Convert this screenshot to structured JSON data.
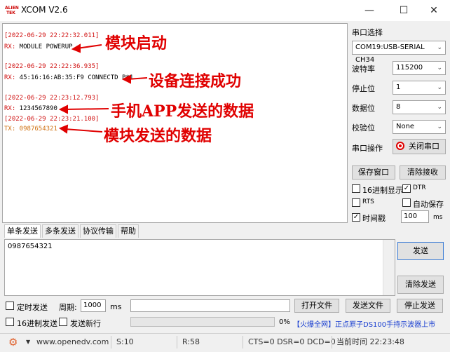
{
  "window": {
    "logo_text": "ALIEN TEK",
    "title": "XCOM V2.6"
  },
  "receive": {
    "lines": [
      {
        "ts": "[2022-06-29 22:22:32.011]",
        "dir": "RX:",
        "text": " MODULE POWERUP"
      },
      {
        "ts": "[2022-06-29 22:22:36.935]",
        "dir": "RX:",
        "text": " 45:16:16:AB:35:F9 CONNECTD P*1"
      },
      {
        "ts": "[2022-06-29 22:23:12.793]",
        "dir": "RX:",
        "text": " 1234567890"
      },
      {
        "ts": "[2022-06-29 22:23:21.100]",
        "dir": "TX:",
        "text": " 0987654321"
      }
    ],
    "annotations": [
      "模块启动",
      "设备连接成功",
      "手机APP发送的数据",
      "模块发送的数据"
    ]
  },
  "settings": {
    "port_select_label": "串口选择",
    "port_value": "COM19:USB-SERIAL CH34",
    "baud_label": "波特率",
    "baud_value": "115200",
    "stopbits_label": "停止位",
    "stopbits_value": "1",
    "databits_label": "数据位",
    "databits_value": "8",
    "parity_label": "校验位",
    "parity_value": "None",
    "port_op_label": "串口操作",
    "close_port_label": "关闭串口",
    "save_window_label": "保存窗口",
    "clear_recv_label": "清除接收",
    "hex_display_label": "16进制显示",
    "dtr_label": "DTR",
    "rts_label": "RTS",
    "auto_save_label": "自动保存",
    "timestamp_label": "时间戳",
    "timestamp_value": "100",
    "timestamp_unit": "ms"
  },
  "tabs": [
    "单条发送",
    "多条发送",
    "协议传输",
    "帮助"
  ],
  "send": {
    "text": "0987654321",
    "send_label": "发送",
    "clear_send_label": "清除发送",
    "timed_send_label": "定时发送",
    "period_label": "周期:",
    "period_value": "1000",
    "period_unit": "ms",
    "open_file_label": "打开文件",
    "send_file_label": "发送文件",
    "stop_send_label": "停止发送",
    "hex_send_label": "16进制发送",
    "send_newline_label": "发送新行",
    "progress": "0%",
    "ad_text": "【火爆全网】正点原子DS100手持示波器上市"
  },
  "status": {
    "url": "www.openedv.com",
    "sent": "S:10",
    "received": "R:58",
    "lines": "CTS=0 DSR=0 DCD=0",
    "time": "当前时间 22:23:48"
  },
  "checks": {
    "dtr": true,
    "timestamp": true,
    "hex_display": false,
    "rts": false,
    "auto_save": false,
    "timed_send": false,
    "hex_send": false,
    "send_newline": false
  }
}
